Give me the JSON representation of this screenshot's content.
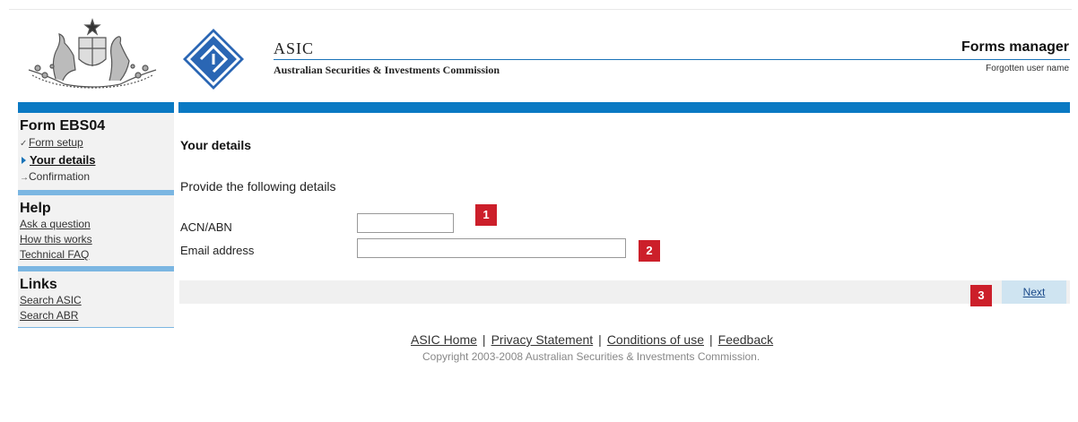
{
  "header": {
    "org_short": "ASIC",
    "org_full": "Australian Securities & Investments Commission",
    "app_title": "Forms manager",
    "forgot_link": "Forgotten user name"
  },
  "sidebar": {
    "form": {
      "heading": "Form EBS04",
      "steps": [
        {
          "label": "Form setup",
          "state": "done",
          "mark": "✓"
        },
        {
          "label": "Your details",
          "state": "current",
          "mark": "▸"
        },
        {
          "label": "Confirmation",
          "state": "pending",
          "mark": "→"
        }
      ]
    },
    "help": {
      "heading": "Help",
      "items": [
        "Ask a question",
        "How this works",
        "Technical FAQ"
      ]
    },
    "links": {
      "heading": "Links",
      "items": [
        "Search ASIC",
        "Search ABR"
      ]
    }
  },
  "main": {
    "title": "Your details",
    "intro": "Provide the following details",
    "fields": {
      "acn": {
        "label": "ACN/ABN",
        "value": ""
      },
      "email": {
        "label": "Email address",
        "value": ""
      }
    },
    "next_label": "Next"
  },
  "badges": [
    "1",
    "2",
    "3"
  ],
  "footer": {
    "links": [
      "ASIC Home",
      "Privacy Statement",
      "Conditions of use",
      "Feedback"
    ],
    "copyright": "Copyright 2003-2008 Australian Securities & Investments Commission."
  },
  "colors": {
    "accent_blue": "#0a79c3",
    "light_blue": "#7bb6e2",
    "badge_red": "#cc1f2a"
  },
  "icons": {
    "logo": "coat-of-arms-icon",
    "brand": "asic-diamond-logo-icon"
  }
}
